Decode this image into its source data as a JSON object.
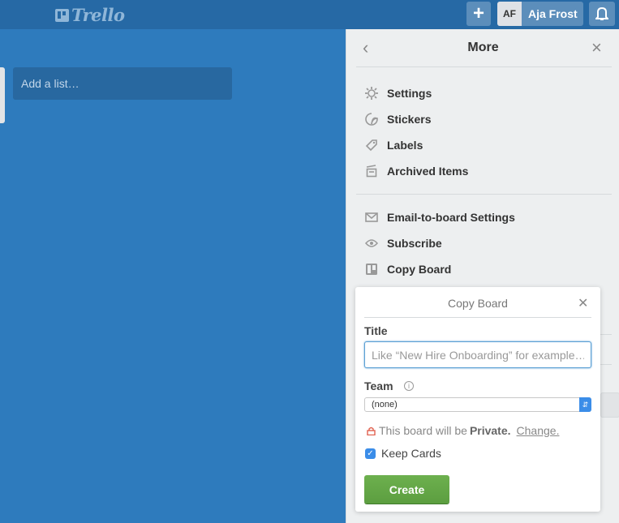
{
  "header": {
    "logo_text": "Trello",
    "add_button": "+",
    "user_initials": "AF",
    "user_name": "Aja Frost"
  },
  "board": {
    "add_list_label": "Add a list…"
  },
  "sidebar": {
    "title": "More",
    "group1": [
      {
        "label": "Settings",
        "icon": "gear-icon"
      },
      {
        "label": "Stickers",
        "icon": "sticker-icon"
      },
      {
        "label": "Labels",
        "icon": "tag-icon"
      },
      {
        "label": "Archived Items",
        "icon": "archive-icon"
      }
    ],
    "group2": [
      {
        "label": "Email-to-board Settings",
        "icon": "envelope-icon"
      },
      {
        "label": "Subscribe",
        "icon": "eye-icon"
      },
      {
        "label": "Copy Board",
        "icon": "board-icon"
      }
    ]
  },
  "copy_popup": {
    "title": "Copy Board",
    "title_label": "Title",
    "title_placeholder": "Like “New Hire Onboarding” for example…",
    "title_value": "",
    "team_label": "Team",
    "team_selected": "(none)",
    "privacy_prefix": "This board will be",
    "privacy_level": "Private.",
    "privacy_change": "Change.",
    "keep_cards_label": "Keep Cards",
    "keep_cards_checked": true,
    "create_label": "Create"
  },
  "colors": {
    "board_bg": "#2e7bbd",
    "header_bg": "#2669a5",
    "create_green": "#61a845",
    "focus_blue": "#5a9fd4"
  }
}
